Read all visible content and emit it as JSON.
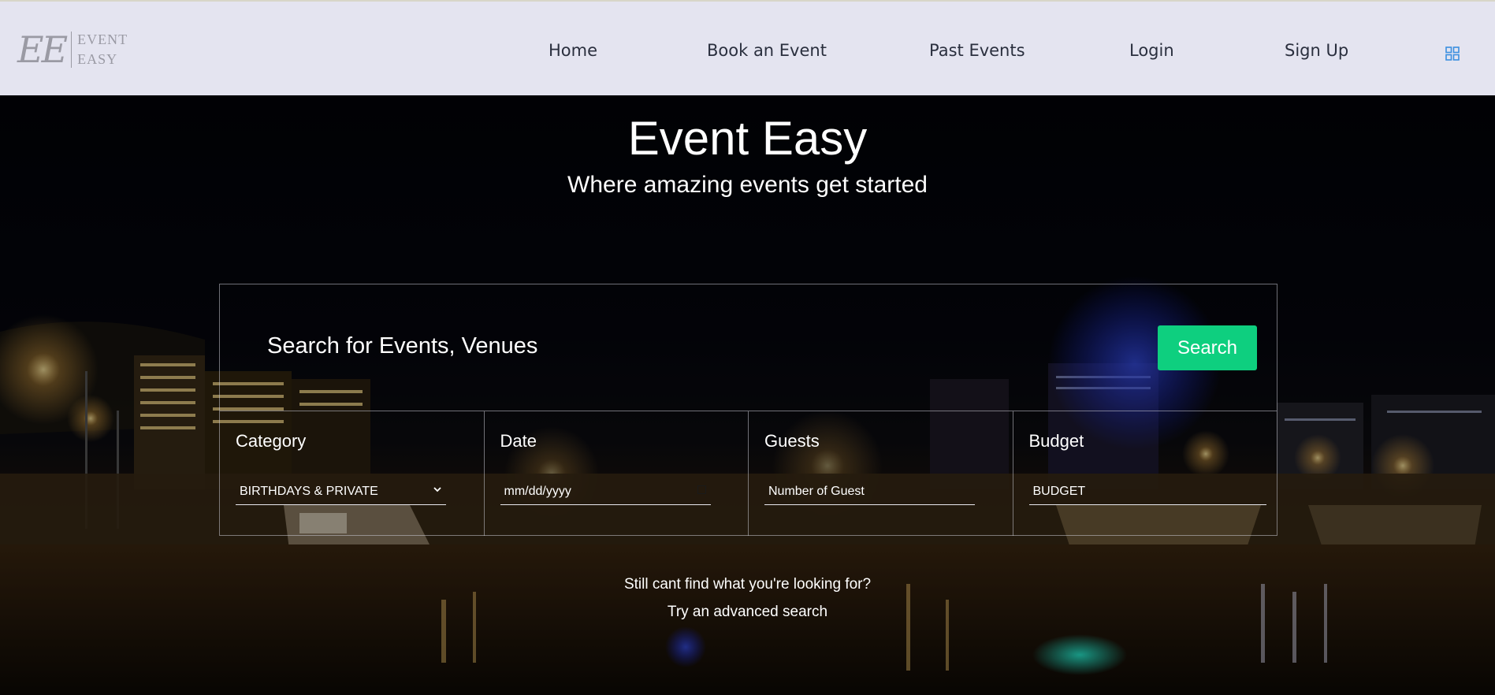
{
  "logo": {
    "mark": "EE",
    "line1": "EVENT",
    "line2": "EASY"
  },
  "nav": {
    "items": [
      {
        "label": "Home"
      },
      {
        "label": "Book an Event"
      },
      {
        "label": "Past Events"
      },
      {
        "label": "Login"
      },
      {
        "label": "Sign Up"
      }
    ],
    "menu_icon": "grid-icon",
    "menu_icon_color": "#3b8fe0"
  },
  "hero": {
    "title": "Event Easy",
    "subtitle": "Where amazing events get started"
  },
  "search": {
    "label": "Search for Events, Venues",
    "button_label": "Search",
    "button_color": "#0ecf7f"
  },
  "filters": {
    "category": {
      "label": "Category",
      "value": "BIRTHDAYS & PRIVATE",
      "icon": "chevron-down-icon"
    },
    "date": {
      "label": "Date",
      "value": "mm/dd/yyyy",
      "icon": "calendar-icon"
    },
    "guests": {
      "label": "Guests",
      "value": "Number of Guest"
    },
    "budget": {
      "label": "Budget",
      "value": "BUDGET"
    }
  },
  "footer": {
    "question": "Still cant find what you're looking for?",
    "advanced_link": "Try an advanced search"
  }
}
